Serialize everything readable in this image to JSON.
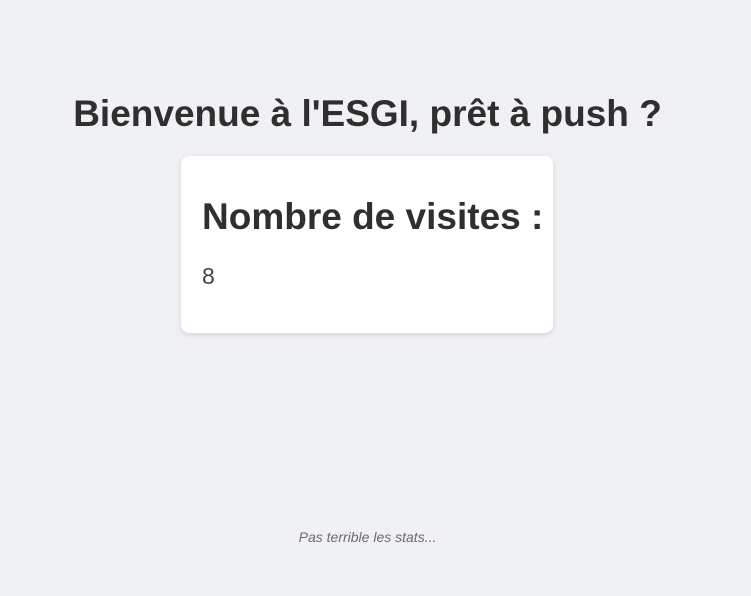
{
  "header": {
    "title": "Bienvenue à l'ESGI, prêt à push ?"
  },
  "visits_card": {
    "heading": "Nombre de visites :",
    "count": "8"
  },
  "footer": {
    "note": "Pas terrible les stats..."
  },
  "colors": {
    "background": "#f0f1f5",
    "card_background": "#ffffff",
    "text": "#2f2f2f",
    "muted_text": "#6b6b6b"
  }
}
